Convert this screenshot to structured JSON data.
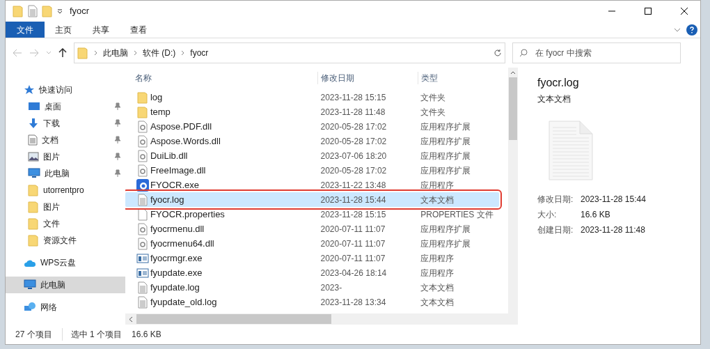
{
  "window": {
    "title": "fyocr"
  },
  "ribbon_tabs": [
    {
      "label": "文件",
      "selected": true
    },
    {
      "label": "主页",
      "selected": false
    },
    {
      "label": "共享",
      "selected": false
    },
    {
      "label": "查看",
      "selected": false
    }
  ],
  "breadcrumb": [
    "此电脑",
    "软件 (D:)",
    "fyocr"
  ],
  "search": {
    "placeholder": "在 fyocr 中搜索"
  },
  "sidebar": {
    "items": [
      {
        "label": "快速访问",
        "kind": "star",
        "pinned": false,
        "selected": false
      },
      {
        "label": "桌面",
        "kind": "desktop",
        "pinned": true,
        "selected": false
      },
      {
        "label": "下载",
        "kind": "download",
        "pinned": true,
        "selected": false
      },
      {
        "label": "文档",
        "kind": "document",
        "pinned": true,
        "selected": false
      },
      {
        "label": "图片",
        "kind": "image",
        "pinned": true,
        "selected": false
      },
      {
        "label": "此电脑",
        "kind": "pc",
        "pinned": true,
        "selected": false
      },
      {
        "label": "utorrentpro",
        "kind": "folder",
        "pinned": false,
        "selected": false
      },
      {
        "label": "图片",
        "kind": "folder",
        "pinned": false,
        "selected": false
      },
      {
        "label": "文件",
        "kind": "folder",
        "pinned": false,
        "selected": false
      },
      {
        "label": "资源文件",
        "kind": "folder",
        "pinned": false,
        "selected": false
      },
      {
        "label": "WPS云盘",
        "kind": "cloud",
        "pinned": false,
        "selected": false
      },
      {
        "label": "此电脑",
        "kind": "pc",
        "pinned": false,
        "selected": true
      },
      {
        "label": "网络",
        "kind": "network",
        "pinned": false,
        "selected": false
      }
    ]
  },
  "table": {
    "columns": [
      "名称",
      "修改日期",
      "类型"
    ],
    "rows": [
      {
        "name": "log",
        "date": "2023-11-28 15:15",
        "type": "文件夹",
        "kind": "folder",
        "selected": false
      },
      {
        "name": "temp",
        "date": "2023-11-28 11:48",
        "type": "文件夹",
        "kind": "folder",
        "selected": false
      },
      {
        "name": "Aspose.PDF.dll",
        "date": "2020-05-28 17:02",
        "type": "应用程序扩展",
        "kind": "dll",
        "selected": false
      },
      {
        "name": "Aspose.Words.dll",
        "date": "2020-05-28 17:02",
        "type": "应用程序扩展",
        "kind": "dll",
        "selected": false
      },
      {
        "name": "DuiLib.dll",
        "date": "2023-07-06 18:20",
        "type": "应用程序扩展",
        "kind": "dll",
        "selected": false
      },
      {
        "name": "FreeImage.dll",
        "date": "2020-05-28 17:02",
        "type": "应用程序扩展",
        "kind": "dll",
        "selected": false
      },
      {
        "name": "FYOCR.exe",
        "date": "2023-11-22 13:48",
        "type": "应用程序",
        "kind": "app",
        "selected": false
      },
      {
        "name": "fyocr.log",
        "date": "2023-11-28 15:44",
        "type": "文本文档",
        "kind": "text",
        "selected": true
      },
      {
        "name": "FYOCR.properties",
        "date": "2023-11-28 15:15",
        "type": "PROPERTIES 文件",
        "kind": "blank",
        "selected": false
      },
      {
        "name": "fyocrmenu.dll",
        "date": "2020-07-11 11:07",
        "type": "应用程序扩展",
        "kind": "dll",
        "selected": false
      },
      {
        "name": "fyocrmenu64.dll",
        "date": "2020-07-11 11:07",
        "type": "应用程序扩展",
        "kind": "dll",
        "selected": false
      },
      {
        "name": "fyocrmgr.exe",
        "date": "2020-07-11 11:07",
        "type": "应用程序",
        "kind": "exe",
        "selected": false
      },
      {
        "name": "fyupdate.exe",
        "date": "2023-04-26 18:14",
        "type": "应用程序",
        "kind": "exe",
        "selected": false
      },
      {
        "name": "fyupdate.log",
        "date": "2023-",
        "type": "文本文档",
        "kind": "text",
        "selected": false
      },
      {
        "name": "fyupdate_old.log",
        "date": "2023-11-28 13:34",
        "type": "文本文档",
        "kind": "text",
        "selected": false
      }
    ]
  },
  "details": {
    "name": "fyocr.log",
    "type": "文本文档",
    "fields": [
      {
        "label": "修改日期:",
        "value": "2023-11-28 15:44"
      },
      {
        "label": "大小:",
        "value": "16.6 KB"
      },
      {
        "label": "创建日期:",
        "value": "2023-11-28 11:48"
      }
    ]
  },
  "status_bar": {
    "count": "27 个项目",
    "selection": "选中 1 个项目",
    "size": "16.6 KB"
  }
}
